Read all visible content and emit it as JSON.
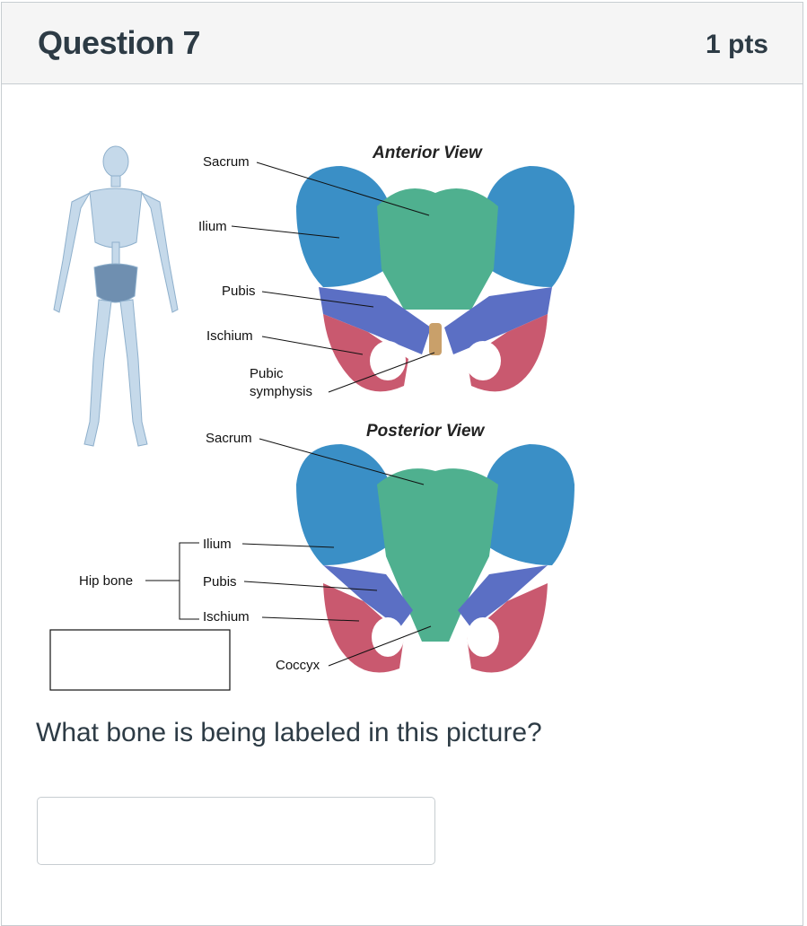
{
  "question": {
    "title": "Question 7",
    "points": "1 pts",
    "prompt": "What bone is being labeled in this picture?",
    "answer_value": ""
  },
  "figure": {
    "anterior": {
      "title": "Anterior View",
      "labels": {
        "sacrum": "Sacrum",
        "ilium": "Ilium",
        "pubis": "Pubis",
        "ischium": "Ischium",
        "pubic_symphysis_1": "Pubic",
        "pubic_symphysis_2": "symphysis"
      }
    },
    "posterior": {
      "title": "Posterior View",
      "labels": {
        "sacrum": "Sacrum",
        "ilium": "Ilium",
        "pubis": "Pubis",
        "ischium": "Ischium",
        "coccyx": "Coccyx",
        "hip_bone": "Hip bone"
      }
    },
    "colors": {
      "ilium": "#3a8fc6",
      "sacrum": "#4fb08f",
      "pubis": "#5b6fc4",
      "ischium": "#c9596f",
      "symphysis": "#c9a06a",
      "skeleton": "#b9d2e6"
    }
  }
}
